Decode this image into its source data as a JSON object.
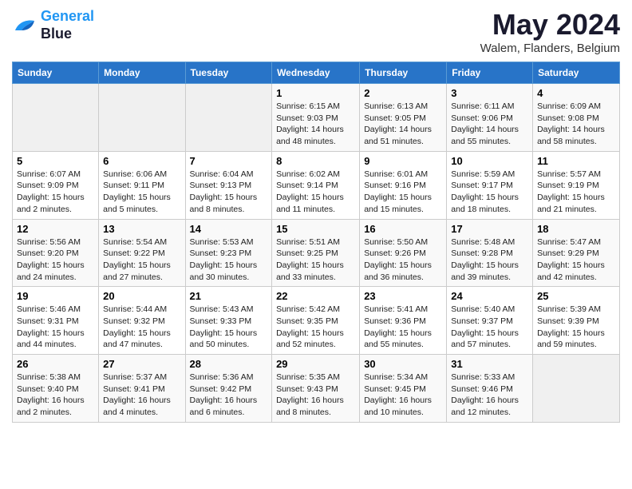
{
  "logo": {
    "line1": "General",
    "line2": "Blue"
  },
  "title": "May 2024",
  "subtitle": "Walem, Flanders, Belgium",
  "days_of_week": [
    "Sunday",
    "Monday",
    "Tuesday",
    "Wednesday",
    "Thursday",
    "Friday",
    "Saturday"
  ],
  "weeks": [
    [
      {
        "day": "",
        "sunrise": "",
        "sunset": "",
        "daylight": "",
        "empty": true
      },
      {
        "day": "",
        "sunrise": "",
        "sunset": "",
        "daylight": "",
        "empty": true
      },
      {
        "day": "",
        "sunrise": "",
        "sunset": "",
        "daylight": "",
        "empty": true
      },
      {
        "day": "1",
        "sunrise": "Sunrise: 6:15 AM",
        "sunset": "Sunset: 9:03 PM",
        "daylight": "Daylight: 14 hours and 48 minutes."
      },
      {
        "day": "2",
        "sunrise": "Sunrise: 6:13 AM",
        "sunset": "Sunset: 9:05 PM",
        "daylight": "Daylight: 14 hours and 51 minutes."
      },
      {
        "day": "3",
        "sunrise": "Sunrise: 6:11 AM",
        "sunset": "Sunset: 9:06 PM",
        "daylight": "Daylight: 14 hours and 55 minutes."
      },
      {
        "day": "4",
        "sunrise": "Sunrise: 6:09 AM",
        "sunset": "Sunset: 9:08 PM",
        "daylight": "Daylight: 14 hours and 58 minutes."
      }
    ],
    [
      {
        "day": "5",
        "sunrise": "Sunrise: 6:07 AM",
        "sunset": "Sunset: 9:09 PM",
        "daylight": "Daylight: 15 hours and 2 minutes."
      },
      {
        "day": "6",
        "sunrise": "Sunrise: 6:06 AM",
        "sunset": "Sunset: 9:11 PM",
        "daylight": "Daylight: 15 hours and 5 minutes."
      },
      {
        "day": "7",
        "sunrise": "Sunrise: 6:04 AM",
        "sunset": "Sunset: 9:13 PM",
        "daylight": "Daylight: 15 hours and 8 minutes."
      },
      {
        "day": "8",
        "sunrise": "Sunrise: 6:02 AM",
        "sunset": "Sunset: 9:14 PM",
        "daylight": "Daylight: 15 hours and 11 minutes."
      },
      {
        "day": "9",
        "sunrise": "Sunrise: 6:01 AM",
        "sunset": "Sunset: 9:16 PM",
        "daylight": "Daylight: 15 hours and 15 minutes."
      },
      {
        "day": "10",
        "sunrise": "Sunrise: 5:59 AM",
        "sunset": "Sunset: 9:17 PM",
        "daylight": "Daylight: 15 hours and 18 minutes."
      },
      {
        "day": "11",
        "sunrise": "Sunrise: 5:57 AM",
        "sunset": "Sunset: 9:19 PM",
        "daylight": "Daylight: 15 hours and 21 minutes."
      }
    ],
    [
      {
        "day": "12",
        "sunrise": "Sunrise: 5:56 AM",
        "sunset": "Sunset: 9:20 PM",
        "daylight": "Daylight: 15 hours and 24 minutes."
      },
      {
        "day": "13",
        "sunrise": "Sunrise: 5:54 AM",
        "sunset": "Sunset: 9:22 PM",
        "daylight": "Daylight: 15 hours and 27 minutes."
      },
      {
        "day": "14",
        "sunrise": "Sunrise: 5:53 AM",
        "sunset": "Sunset: 9:23 PM",
        "daylight": "Daylight: 15 hours and 30 minutes."
      },
      {
        "day": "15",
        "sunrise": "Sunrise: 5:51 AM",
        "sunset": "Sunset: 9:25 PM",
        "daylight": "Daylight: 15 hours and 33 minutes."
      },
      {
        "day": "16",
        "sunrise": "Sunrise: 5:50 AM",
        "sunset": "Sunset: 9:26 PM",
        "daylight": "Daylight: 15 hours and 36 minutes."
      },
      {
        "day": "17",
        "sunrise": "Sunrise: 5:48 AM",
        "sunset": "Sunset: 9:28 PM",
        "daylight": "Daylight: 15 hours and 39 minutes."
      },
      {
        "day": "18",
        "sunrise": "Sunrise: 5:47 AM",
        "sunset": "Sunset: 9:29 PM",
        "daylight": "Daylight: 15 hours and 42 minutes."
      }
    ],
    [
      {
        "day": "19",
        "sunrise": "Sunrise: 5:46 AM",
        "sunset": "Sunset: 9:31 PM",
        "daylight": "Daylight: 15 hours and 44 minutes."
      },
      {
        "day": "20",
        "sunrise": "Sunrise: 5:44 AM",
        "sunset": "Sunset: 9:32 PM",
        "daylight": "Daylight: 15 hours and 47 minutes."
      },
      {
        "day": "21",
        "sunrise": "Sunrise: 5:43 AM",
        "sunset": "Sunset: 9:33 PM",
        "daylight": "Daylight: 15 hours and 50 minutes."
      },
      {
        "day": "22",
        "sunrise": "Sunrise: 5:42 AM",
        "sunset": "Sunset: 9:35 PM",
        "daylight": "Daylight: 15 hours and 52 minutes."
      },
      {
        "day": "23",
        "sunrise": "Sunrise: 5:41 AM",
        "sunset": "Sunset: 9:36 PM",
        "daylight": "Daylight: 15 hours and 55 minutes."
      },
      {
        "day": "24",
        "sunrise": "Sunrise: 5:40 AM",
        "sunset": "Sunset: 9:37 PM",
        "daylight": "Daylight: 15 hours and 57 minutes."
      },
      {
        "day": "25",
        "sunrise": "Sunrise: 5:39 AM",
        "sunset": "Sunset: 9:39 PM",
        "daylight": "Daylight: 15 hours and 59 minutes."
      }
    ],
    [
      {
        "day": "26",
        "sunrise": "Sunrise: 5:38 AM",
        "sunset": "Sunset: 9:40 PM",
        "daylight": "Daylight: 16 hours and 2 minutes."
      },
      {
        "day": "27",
        "sunrise": "Sunrise: 5:37 AM",
        "sunset": "Sunset: 9:41 PM",
        "daylight": "Daylight: 16 hours and 4 minutes."
      },
      {
        "day": "28",
        "sunrise": "Sunrise: 5:36 AM",
        "sunset": "Sunset: 9:42 PM",
        "daylight": "Daylight: 16 hours and 6 minutes."
      },
      {
        "day": "29",
        "sunrise": "Sunrise: 5:35 AM",
        "sunset": "Sunset: 9:43 PM",
        "daylight": "Daylight: 16 hours and 8 minutes."
      },
      {
        "day": "30",
        "sunrise": "Sunrise: 5:34 AM",
        "sunset": "Sunset: 9:45 PM",
        "daylight": "Daylight: 16 hours and 10 minutes."
      },
      {
        "day": "31",
        "sunrise": "Sunrise: 5:33 AM",
        "sunset": "Sunset: 9:46 PM",
        "daylight": "Daylight: 16 hours and 12 minutes."
      },
      {
        "day": "",
        "sunrise": "",
        "sunset": "",
        "daylight": "",
        "empty": true
      }
    ]
  ]
}
